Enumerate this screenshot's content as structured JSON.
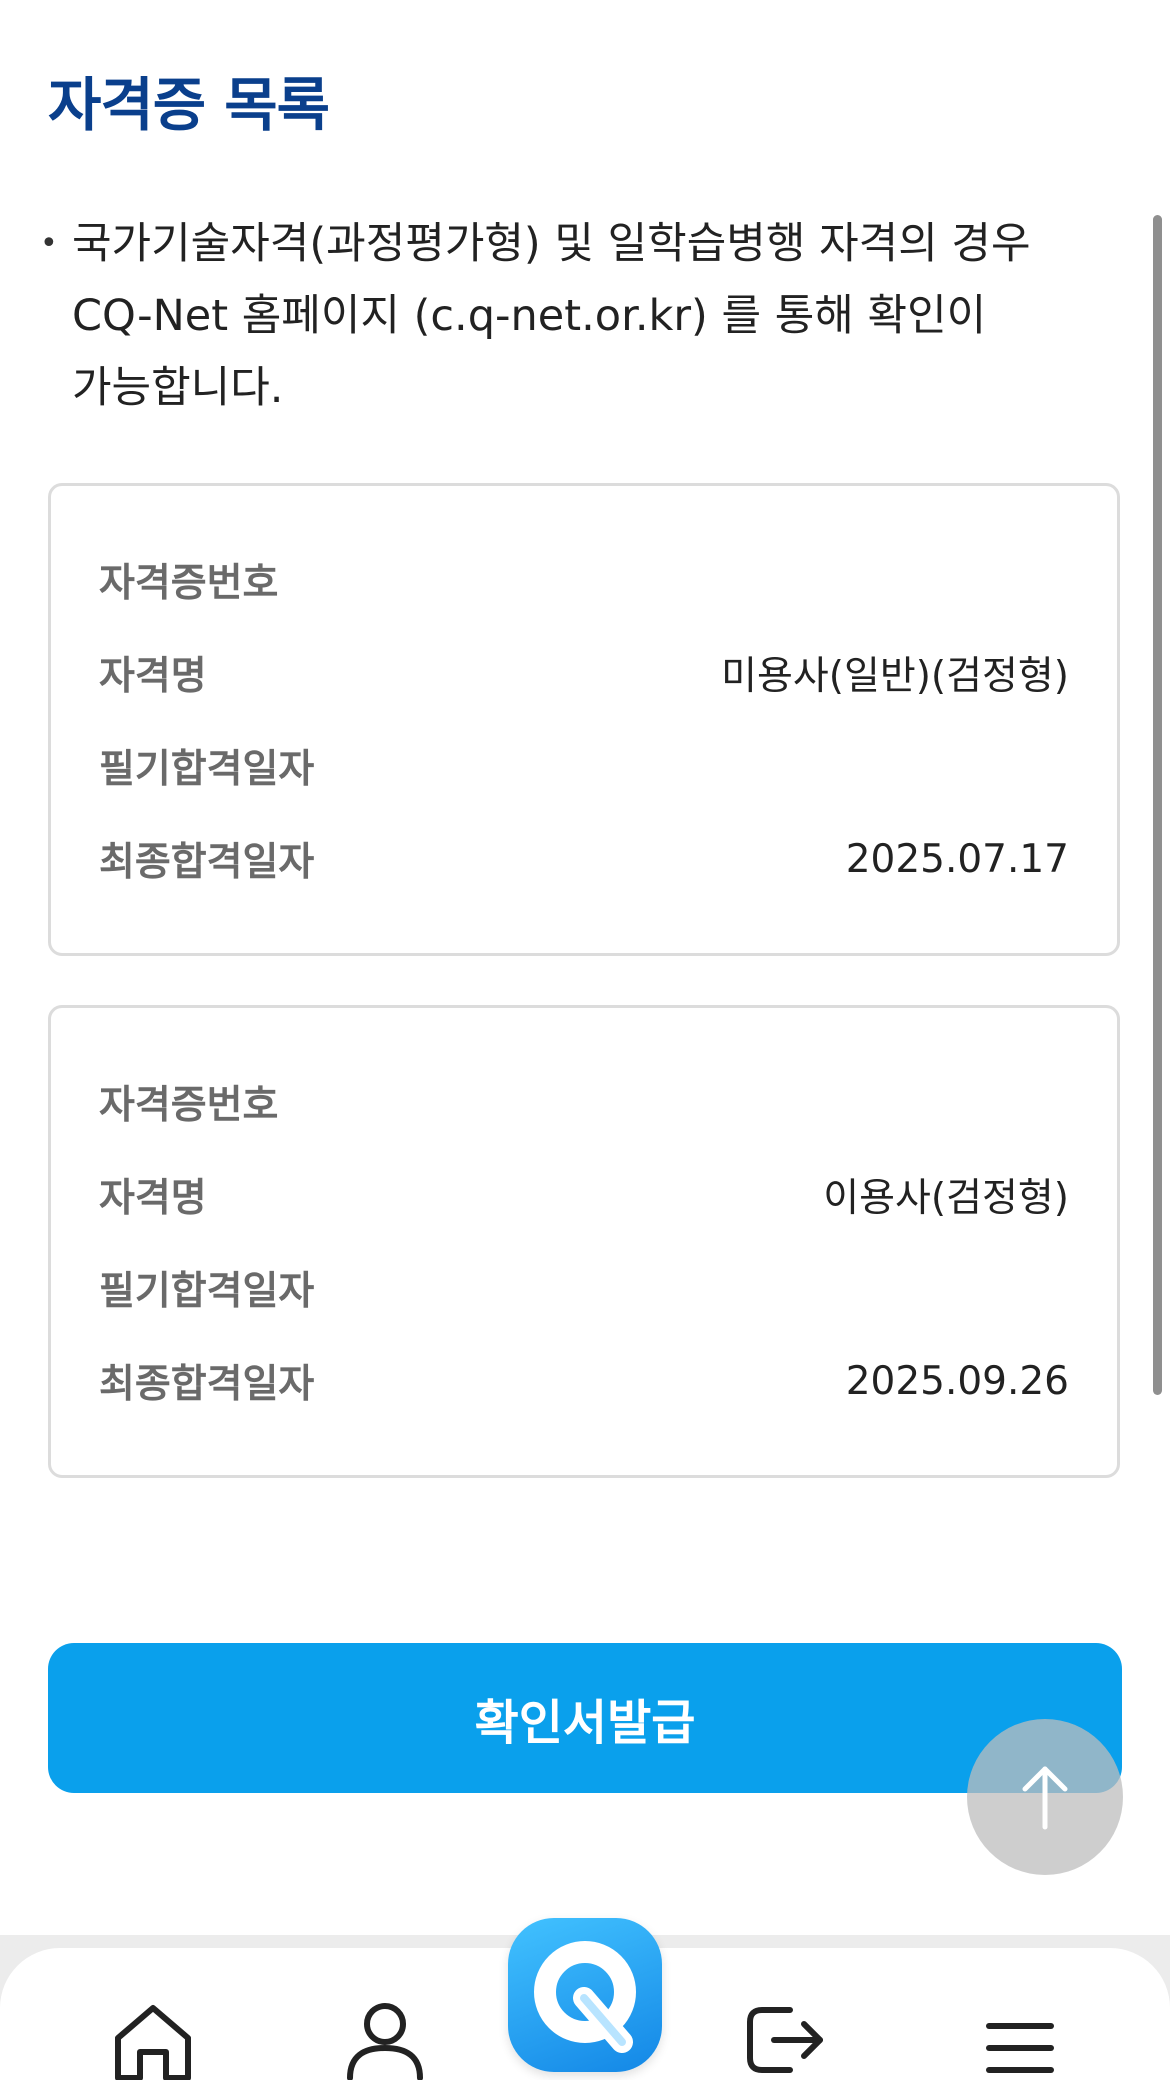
{
  "header": {
    "title": "자격증 목록"
  },
  "notice": {
    "bullet": "•",
    "text_lines": [
      "국가기술자격(과정평가형) 및 일학습병행 자격의 경우",
      "CQ-Net 홈페이지 (c.q-net.or.kr) 를 통해 확인이",
      "가능합니다."
    ]
  },
  "certificates": [
    {
      "rows": [
        {
          "label": "자격증번호",
          "value": ""
        },
        {
          "label": "자격명",
          "value": "미용사(일반)(검정형)"
        },
        {
          "label": "필기합격일자",
          "value": ""
        },
        {
          "label": "최종합격일자",
          "value": "2025.07.17"
        }
      ]
    },
    {
      "rows": [
        {
          "label": "자격증번호",
          "value": ""
        },
        {
          "label": "자격명",
          "value": "이용사(검정형)"
        },
        {
          "label": "필기합격일자",
          "value": ""
        },
        {
          "label": "최종합격일자",
          "value": "2025.09.26"
        }
      ]
    }
  ],
  "actions": {
    "issue_button_label": "확인서발급"
  },
  "icons": {
    "scroll_top": "arrow-up-icon",
    "nav": [
      "home-icon",
      "user-icon",
      "app-logo-icon",
      "logout-icon",
      "menu-icon"
    ]
  },
  "colors": {
    "title": "#0a3f8c",
    "primary_button": "#0aa0ec",
    "logo_gradient_start": "#42c2ff",
    "logo_gradient_end": "#1387e6"
  }
}
